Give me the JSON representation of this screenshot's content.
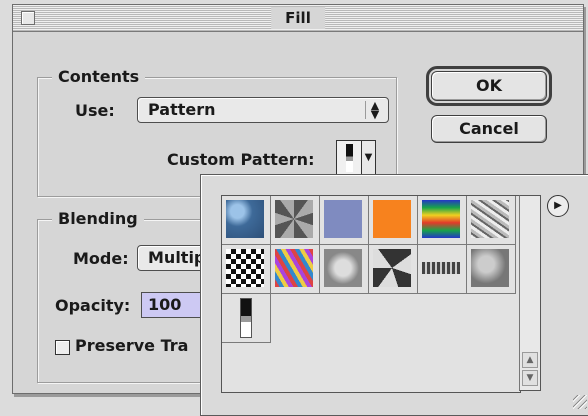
{
  "dialog": {
    "title": "Fill",
    "ok_label": "OK",
    "cancel_label": "Cancel"
  },
  "contents": {
    "group_label": "Contents",
    "use_label": "Use:",
    "use_value": "Pattern",
    "custom_pattern_label": "Custom Pattern:"
  },
  "blending": {
    "group_label": "Blending",
    "mode_label": "Mode:",
    "mode_value": "Multip",
    "opacity_label": "Opacity:",
    "opacity_value": "100",
    "preserve_label": "Preserve Tra"
  },
  "pattern_picker": {
    "patterns": [
      {
        "name": "bubbles",
        "color": "#4f7fb0"
      },
      {
        "name": "noise-gray",
        "color": "#777777"
      },
      {
        "name": "blue-gray",
        "color": "#7f8bc0"
      },
      {
        "name": "orange",
        "color": "#f7821e"
      },
      {
        "name": "rainbow",
        "color": "#c0395a"
      },
      {
        "name": "crumpled",
        "color": "#9a9a9a"
      },
      {
        "name": "checker",
        "color": "#222222"
      },
      {
        "name": "confetti",
        "color": "#b15cc0"
      },
      {
        "name": "stones",
        "color": "#a8a8a8"
      },
      {
        "name": "gravel",
        "color": "#8a8a8a"
      },
      {
        "name": "rope",
        "color": "#5a5a5a"
      },
      {
        "name": "rocks",
        "color": "#9f9f9f"
      },
      {
        "name": "custom-gradient",
        "color": "#111111"
      }
    ]
  }
}
